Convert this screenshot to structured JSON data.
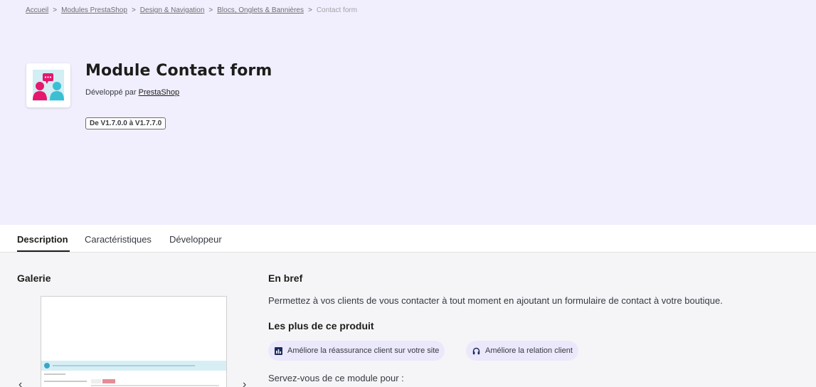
{
  "breadcrumb": {
    "items": [
      "Accueil",
      "Modules PrestaShop",
      "Design & Navigation",
      "Blocs, Onglets & Bannières"
    ],
    "separator": ">",
    "current": "Contact form"
  },
  "module": {
    "title": "Module Contact form",
    "developed_by_prefix": "Développé par",
    "developer": "PrestaShop",
    "version_badge": "De V1.7.0.0 à V1.7.7.0",
    "logo_icon": "contact-people-chat-icon"
  },
  "tabs": [
    {
      "label": "Description",
      "active": true
    },
    {
      "label": "Caractéristiques",
      "active": false
    },
    {
      "label": "Développeur",
      "active": false
    }
  ],
  "gallery": {
    "title": "Galerie",
    "prev_icon": "chevron-left-icon",
    "next_icon": "chevron-right-icon",
    "prev_glyph": "‹",
    "next_glyph": "›"
  },
  "content": {
    "summary_title": "En bref",
    "summary_text": "Permettez à vos clients de vous contacter à tout moment en ajoutant un formulaire de contact à votre boutique.",
    "benefits_title": "Les plus de ce produit",
    "benefits": [
      {
        "label": "Améliore la réassurance client sur votre site",
        "icon": "chart-icon"
      },
      {
        "label": "Améliore la relation client",
        "icon": "headphones-icon"
      }
    ],
    "use_title": "Servez-vous de ce module pour :"
  },
  "colors": {
    "hero_bg": "#f1effd",
    "chip_bg": "#ebe8fb",
    "logo_pink": "#e6176d",
    "logo_teal": "#3bbfd3"
  }
}
